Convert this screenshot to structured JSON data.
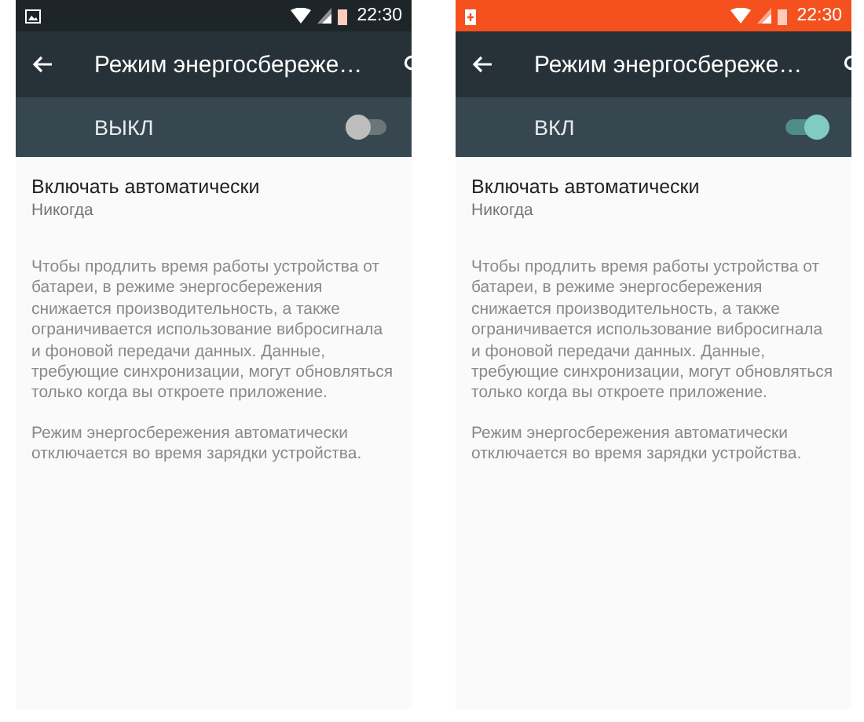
{
  "phones": [
    {
      "status_bar": {
        "time": "22:30",
        "battery_saver": false
      },
      "toolbar": {
        "title": "Режим энергосбереже…"
      },
      "master_switch": {
        "label": "ВЫКЛ",
        "on": false
      },
      "setting": {
        "title": "Включать автоматически",
        "value": "Никогда"
      },
      "paragraphs": [
        "Чтобы продлить время работы устройства от батареи, в режиме энергосбережения снижается производительность, а также ограничивается использование вибросигнала и фоновой передачи данных. Данные, требующие синхронизации, могут обновляться только когда вы откроете приложение.",
        "Режим энергосбережения автоматически отключается во время зарядки устройства."
      ]
    },
    {
      "status_bar": {
        "time": "22:30",
        "battery_saver": true
      },
      "toolbar": {
        "title": "Режим энергосбереже…"
      },
      "master_switch": {
        "label": "ВКЛ",
        "on": true
      },
      "setting": {
        "title": "Включать автоматически",
        "value": "Никогда"
      },
      "paragraphs": [
        "Чтобы продлить время работы устройства от батареи, в режиме энергосбережения снижается производительность, а также ограничивается использование вибросигнала и фоновой передачи данных. Данные, требующие синхронизации, могут обновляться только когда вы откроете приложение.",
        "Режим энергосбережения автоматически отключается во время зарядки устройства."
      ]
    }
  ]
}
